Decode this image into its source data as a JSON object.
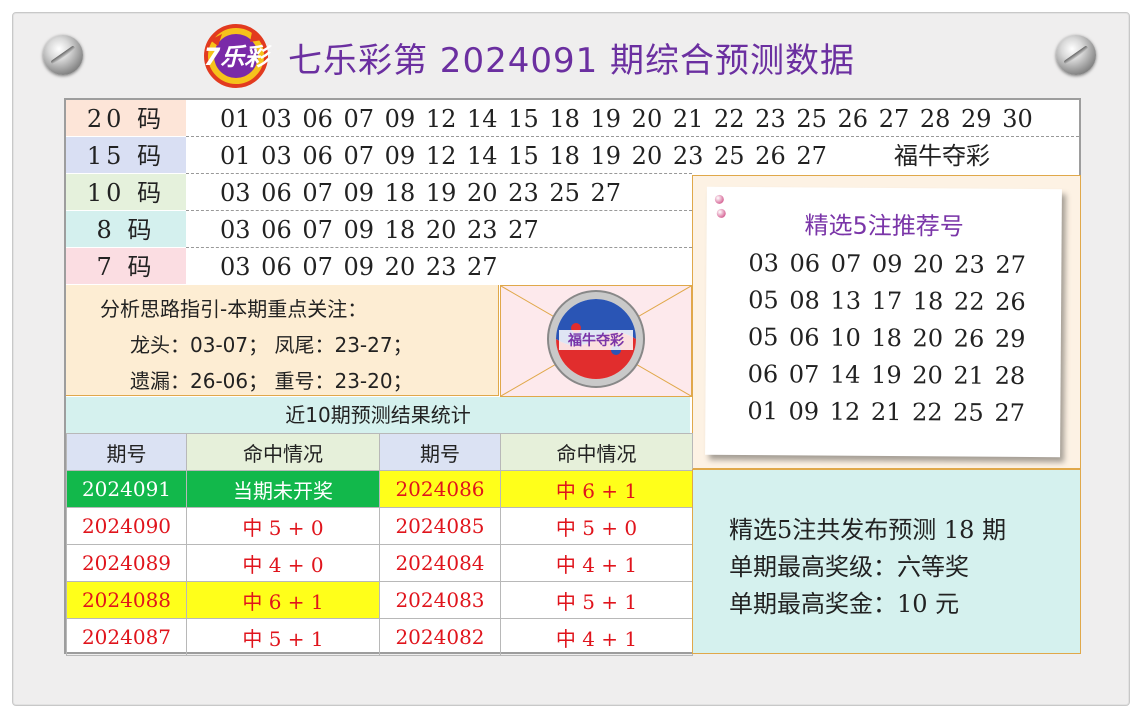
{
  "header": {
    "title": "七乐彩第 2024091 期综合预测数据",
    "logo_text": "7乐彩"
  },
  "number_rows": [
    {
      "label": "20 码",
      "numbers": "01 03 06 07 09 12 14 15 18 19 20 21 22 23 25 26 27 28 29 30",
      "bg": "#fde5d8"
    },
    {
      "label": "15 码",
      "numbers": "01 03 06 07 09 12 14 15 18 19 20 23 25 26 27",
      "bg": "#d9dff3"
    },
    {
      "label": "10 码",
      "numbers": "03 06 07 09 18 19 20 23 25 27",
      "bg": "#e5f1dc"
    },
    {
      "label": "8 码",
      "numbers": "03 06 07 09 18 20 23 27",
      "bg": "#d4f0ee"
    },
    {
      "label": "7 码",
      "numbers": "03 06 07 09 20 23 27",
      "bg": "#fbdde2"
    }
  ],
  "brand_note": "福牛夺彩",
  "analysis": {
    "heading": "分析思路指引-本期重点关注：",
    "line1": "龙头：03-07；   凤尾：23-27；",
    "line2": "遗漏：26-06；   重号：23-20；"
  },
  "emblem_text": "福牛夺彩",
  "stats": {
    "title": "近10期预测结果统计",
    "col_period": "期号",
    "col_result": "命中情况",
    "rows": [
      {
        "p1": "2024091",
        "r1": "当期未开奖",
        "p2": "2024086",
        "r2": "中 6 + 1"
      },
      {
        "p1": "2024090",
        "r1": "中 5 + 0",
        "p2": "2024085",
        "r2": "中 5 + 0"
      },
      {
        "p1": "2024089",
        "r1": "中 4 + 0",
        "p2": "2024084",
        "r2": "中 4 + 1"
      },
      {
        "p1": "2024088",
        "r1": "中 6 + 1",
        "p2": "2024083",
        "r2": "中 5 + 1"
      },
      {
        "p1": "2024087",
        "r1": "中 5 + 1",
        "p2": "2024082",
        "r2": "中 4 + 1"
      }
    ]
  },
  "recommend": {
    "title": "精选5注推荐号",
    "lines": [
      "03 06 07 09 20 23 27",
      "05 08 13 17 18 22 26",
      "05 06 10 18 20 26 29",
      "06 07 14 19 20 21 28",
      "01 09 12 21 22 25 27"
    ]
  },
  "summary": {
    "line1": "精选5注共发布预测 18 期",
    "line2": "单期最高奖级：六等奖",
    "line3": "单期最高奖金：10 元"
  },
  "colors": {
    "title_purple": "#6b2fa0",
    "hit_red": "#e0141c",
    "highlight_yellow": "#ffff1a",
    "current_green": "#12b84b"
  }
}
